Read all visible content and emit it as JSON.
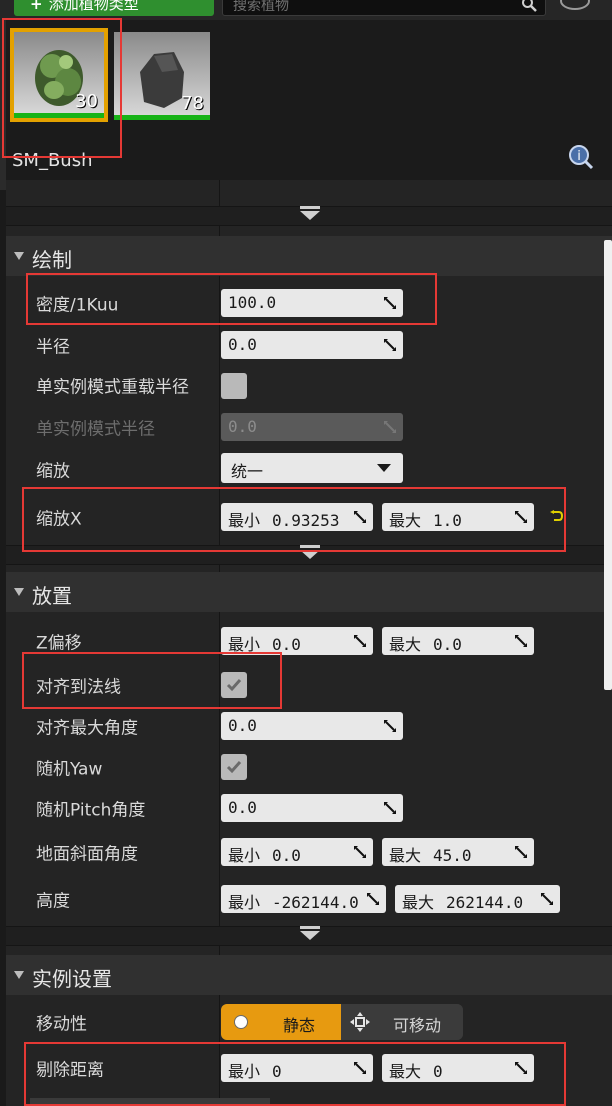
{
  "toolbar": {
    "add_label": "添加植物类型",
    "search_placeholder": "搜索植物"
  },
  "foliage": {
    "items": [
      {
        "count": "30",
        "selected": true
      },
      {
        "count": "78",
        "selected": false
      }
    ],
    "selected_name": "SM_Bush"
  },
  "sections": {
    "paint": {
      "title": "绘制",
      "density_label": "密度/1Kuu",
      "density_value": "100.0",
      "radius_label": "半径",
      "radius_value": "0.0",
      "single_override_label": "单实例模式重载半径",
      "single_radius_label": "单实例模式半径",
      "single_radius_value": "0.0",
      "scaling_label": "缩放",
      "scaling_value": "统一",
      "scale_x_label": "缩放X",
      "scale_x_min_prefix": "最小",
      "scale_x_min": "0.93253",
      "scale_x_max_prefix": "最大",
      "scale_x_max": "1.0"
    },
    "placement": {
      "title": "放置",
      "z_offset_label": "Z偏移",
      "z_offset_min_prefix": "最小",
      "z_offset_min": "0.0",
      "z_offset_max_prefix": "最大",
      "z_offset_max": "0.0",
      "align_normal_label": "对齐到法线",
      "align_normal_checked": true,
      "align_max_angle_label": "对齐最大角度",
      "align_max_angle_value": "0.0",
      "random_yaw_label": "随机Yaw",
      "random_yaw_checked": true,
      "random_pitch_label": "随机Pitch角度",
      "random_pitch_value": "0.0",
      "ground_slope_label": "地面斜面角度",
      "ground_slope_min_prefix": "最小",
      "ground_slope_min": "0.0",
      "ground_slope_max_prefix": "最大",
      "ground_slope_max": "45.0",
      "height_label": "高度",
      "height_min_prefix": "最小",
      "height_min": "-262144.0",
      "height_max_prefix": "最大",
      "height_max": "262144.0"
    },
    "instance": {
      "title": "实例设置",
      "mobility_label": "移动性",
      "mobility_static": "静态",
      "mobility_movable": "可移动",
      "mobility_selected": "静态",
      "cull_label": "剔除距离",
      "cull_min_prefix": "最小",
      "cull_min": "0",
      "cull_max_prefix": "最大",
      "cull_max": "0"
    }
  },
  "colors": {
    "highlight": "#e53935",
    "selected_thumb_border": "#e3a100",
    "mobility_active": "#e79a10",
    "add_button": "#2f8f2f"
  },
  "icons": [
    "search-icon",
    "settings-icon",
    "help-icon",
    "spin-icon",
    "checkmark-icon",
    "reset-icon",
    "move-icon",
    "chevron-down-icon"
  ]
}
